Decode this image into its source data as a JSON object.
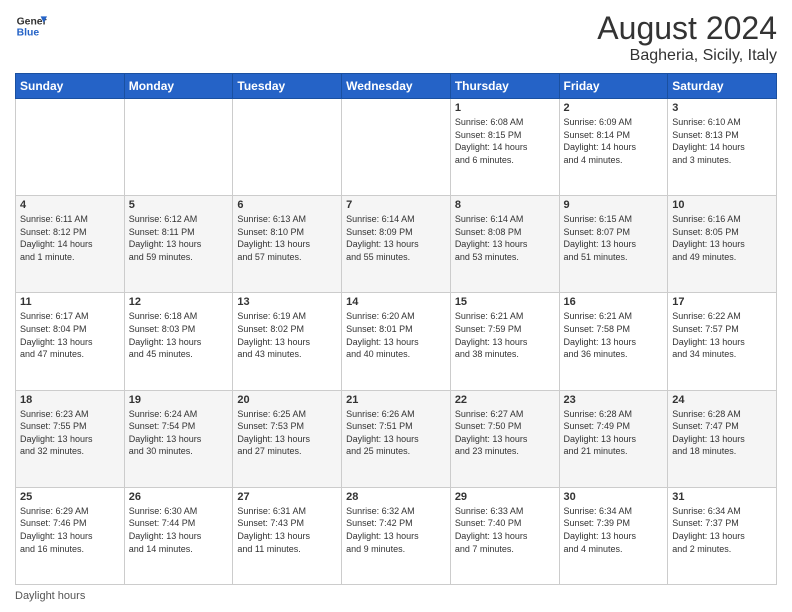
{
  "logo": {
    "line1": "General",
    "line2": "Blue"
  },
  "title": "August 2024",
  "subtitle": "Bagheria, Sicily, Italy",
  "days_header": [
    "Sunday",
    "Monday",
    "Tuesday",
    "Wednesday",
    "Thursday",
    "Friday",
    "Saturday"
  ],
  "weeks": [
    [
      {
        "day": "",
        "info": ""
      },
      {
        "day": "",
        "info": ""
      },
      {
        "day": "",
        "info": ""
      },
      {
        "day": "",
        "info": ""
      },
      {
        "day": "1",
        "info": "Sunrise: 6:08 AM\nSunset: 8:15 PM\nDaylight: 14 hours\nand 6 minutes."
      },
      {
        "day": "2",
        "info": "Sunrise: 6:09 AM\nSunset: 8:14 PM\nDaylight: 14 hours\nand 4 minutes."
      },
      {
        "day": "3",
        "info": "Sunrise: 6:10 AM\nSunset: 8:13 PM\nDaylight: 14 hours\nand 3 minutes."
      }
    ],
    [
      {
        "day": "4",
        "info": "Sunrise: 6:11 AM\nSunset: 8:12 PM\nDaylight: 14 hours\nand 1 minute."
      },
      {
        "day": "5",
        "info": "Sunrise: 6:12 AM\nSunset: 8:11 PM\nDaylight: 13 hours\nand 59 minutes."
      },
      {
        "day": "6",
        "info": "Sunrise: 6:13 AM\nSunset: 8:10 PM\nDaylight: 13 hours\nand 57 minutes."
      },
      {
        "day": "7",
        "info": "Sunrise: 6:14 AM\nSunset: 8:09 PM\nDaylight: 13 hours\nand 55 minutes."
      },
      {
        "day": "8",
        "info": "Sunrise: 6:14 AM\nSunset: 8:08 PM\nDaylight: 13 hours\nand 53 minutes."
      },
      {
        "day": "9",
        "info": "Sunrise: 6:15 AM\nSunset: 8:07 PM\nDaylight: 13 hours\nand 51 minutes."
      },
      {
        "day": "10",
        "info": "Sunrise: 6:16 AM\nSunset: 8:05 PM\nDaylight: 13 hours\nand 49 minutes."
      }
    ],
    [
      {
        "day": "11",
        "info": "Sunrise: 6:17 AM\nSunset: 8:04 PM\nDaylight: 13 hours\nand 47 minutes."
      },
      {
        "day": "12",
        "info": "Sunrise: 6:18 AM\nSunset: 8:03 PM\nDaylight: 13 hours\nand 45 minutes."
      },
      {
        "day": "13",
        "info": "Sunrise: 6:19 AM\nSunset: 8:02 PM\nDaylight: 13 hours\nand 43 minutes."
      },
      {
        "day": "14",
        "info": "Sunrise: 6:20 AM\nSunset: 8:01 PM\nDaylight: 13 hours\nand 40 minutes."
      },
      {
        "day": "15",
        "info": "Sunrise: 6:21 AM\nSunset: 7:59 PM\nDaylight: 13 hours\nand 38 minutes."
      },
      {
        "day": "16",
        "info": "Sunrise: 6:21 AM\nSunset: 7:58 PM\nDaylight: 13 hours\nand 36 minutes."
      },
      {
        "day": "17",
        "info": "Sunrise: 6:22 AM\nSunset: 7:57 PM\nDaylight: 13 hours\nand 34 minutes."
      }
    ],
    [
      {
        "day": "18",
        "info": "Sunrise: 6:23 AM\nSunset: 7:55 PM\nDaylight: 13 hours\nand 32 minutes."
      },
      {
        "day": "19",
        "info": "Sunrise: 6:24 AM\nSunset: 7:54 PM\nDaylight: 13 hours\nand 30 minutes."
      },
      {
        "day": "20",
        "info": "Sunrise: 6:25 AM\nSunset: 7:53 PM\nDaylight: 13 hours\nand 27 minutes."
      },
      {
        "day": "21",
        "info": "Sunrise: 6:26 AM\nSunset: 7:51 PM\nDaylight: 13 hours\nand 25 minutes."
      },
      {
        "day": "22",
        "info": "Sunrise: 6:27 AM\nSunset: 7:50 PM\nDaylight: 13 hours\nand 23 minutes."
      },
      {
        "day": "23",
        "info": "Sunrise: 6:28 AM\nSunset: 7:49 PM\nDaylight: 13 hours\nand 21 minutes."
      },
      {
        "day": "24",
        "info": "Sunrise: 6:28 AM\nSunset: 7:47 PM\nDaylight: 13 hours\nand 18 minutes."
      }
    ],
    [
      {
        "day": "25",
        "info": "Sunrise: 6:29 AM\nSunset: 7:46 PM\nDaylight: 13 hours\nand 16 minutes."
      },
      {
        "day": "26",
        "info": "Sunrise: 6:30 AM\nSunset: 7:44 PM\nDaylight: 13 hours\nand 14 minutes."
      },
      {
        "day": "27",
        "info": "Sunrise: 6:31 AM\nSunset: 7:43 PM\nDaylight: 13 hours\nand 11 minutes."
      },
      {
        "day": "28",
        "info": "Sunrise: 6:32 AM\nSunset: 7:42 PM\nDaylight: 13 hours\nand 9 minutes."
      },
      {
        "day": "29",
        "info": "Sunrise: 6:33 AM\nSunset: 7:40 PM\nDaylight: 13 hours\nand 7 minutes."
      },
      {
        "day": "30",
        "info": "Sunrise: 6:34 AM\nSunset: 7:39 PM\nDaylight: 13 hours\nand 4 minutes."
      },
      {
        "day": "31",
        "info": "Sunrise: 6:34 AM\nSunset: 7:37 PM\nDaylight: 13 hours\nand 2 minutes."
      }
    ]
  ],
  "footer": "Daylight hours"
}
